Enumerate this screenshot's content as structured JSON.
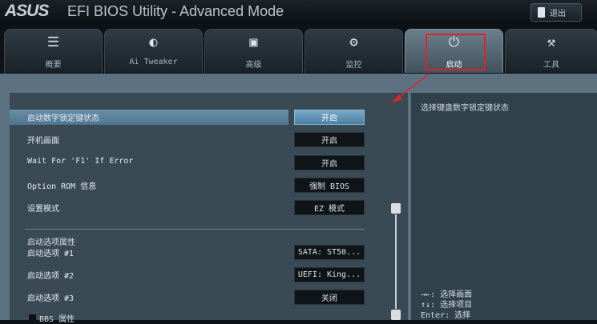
{
  "header": {
    "logo": "ASUS",
    "title": "EFI BIOS Utility - Advanced Mode",
    "exit_label": "退出"
  },
  "tabs": [
    {
      "icon": "☰",
      "icon_name": "list-icon",
      "label": "概要"
    },
    {
      "icon": "◐",
      "icon_name": "ai-tweaker-icon",
      "label": "Ai Tweaker"
    },
    {
      "icon": "▣",
      "icon_name": "advanced-icon",
      "label": "高级"
    },
    {
      "icon": "⚙",
      "icon_name": "monitor-icon",
      "label": "监控"
    },
    {
      "icon": "⏻",
      "icon_name": "power-icon",
      "label": "启动"
    },
    {
      "icon": "⚒",
      "icon_name": "tool-icon",
      "label": "工具"
    }
  ],
  "active_tab": 4,
  "colors": {
    "highlight": "#d9262a",
    "selected": "#5a83a0"
  },
  "settings": [
    {
      "label": "启动数字锁定键状态",
      "value": "开启"
    },
    {
      "label": "开机画面",
      "value": "开启"
    },
    {
      "label": "Wait For 'F1' If Error",
      "value": "开启"
    },
    {
      "label": "Option ROM 信息",
      "value": "强制 BIOS"
    },
    {
      "label": "设置模式",
      "value": "EZ 模式"
    }
  ],
  "boot_section": {
    "title": "启动选项属性",
    "items": [
      {
        "label": "启动选项 #1",
        "value": "SATA: ST50..."
      },
      {
        "label": "启动选项 #2",
        "value": "UEFI: King..."
      },
      {
        "label": "启动选项 #3",
        "value": "关闭"
      }
    ],
    "next_item": "BBS 属性"
  },
  "help": {
    "description": "选择键盘数字锁定键状态",
    "hotkeys": [
      "→←: 选择画面",
      "↑↓: 选择项目",
      "Enter: 选择"
    ]
  }
}
